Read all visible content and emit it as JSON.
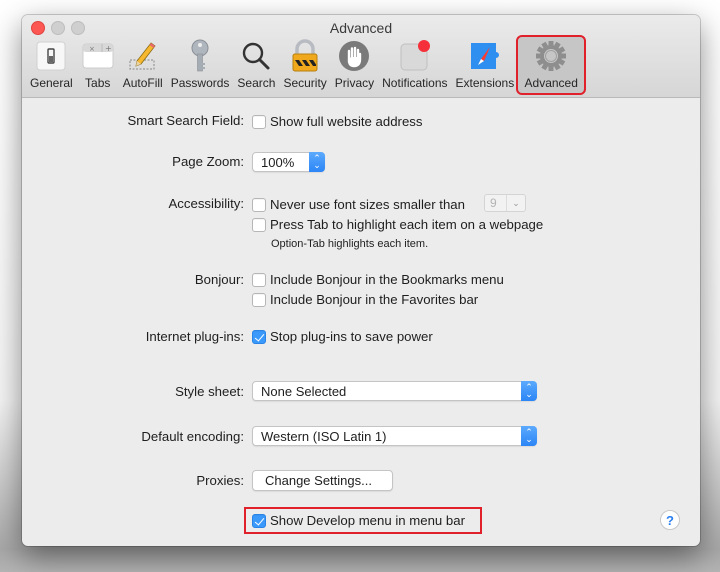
{
  "window": {
    "title": "Advanced",
    "controls": [
      "close",
      "minimize",
      "zoom"
    ]
  },
  "toolbar": {
    "items": [
      {
        "label": "General",
        "icon": "general-switch-icon"
      },
      {
        "label": "Tabs",
        "icon": "tabs-icon"
      },
      {
        "label": "AutoFill",
        "icon": "pencil-icon"
      },
      {
        "label": "Passwords",
        "icon": "key-icon"
      },
      {
        "label": "Search",
        "icon": "magnifier-icon"
      },
      {
        "label": "Security",
        "icon": "padlock-icon"
      },
      {
        "label": "Privacy",
        "icon": "hand-icon"
      },
      {
        "label": "Notifications",
        "icon": "notification-badge-icon"
      },
      {
        "label": "Extensions",
        "icon": "puzzle-compass-icon"
      },
      {
        "label": "Advanced",
        "icon": "gear-icon",
        "selected": true
      }
    ]
  },
  "settings": {
    "smart_search": {
      "label": "Smart Search Field:",
      "option": "Show full website address",
      "checked": false
    },
    "page_zoom": {
      "label": "Page Zoom:",
      "value": "100%"
    },
    "accessibility": {
      "label": "Accessibility:",
      "font_option": "Never use font sizes smaller than",
      "font_checked": false,
      "font_size_value": "9",
      "tab_option": "Press Tab to highlight each item on a webpage",
      "tab_checked": false,
      "note": "Option-Tab highlights each item."
    },
    "bonjour": {
      "label": "Bonjour:",
      "bookmarks_option": "Include Bonjour in the Bookmarks menu",
      "bookmarks_checked": false,
      "favorites_option": "Include Bonjour in the Favorites bar",
      "favorites_checked": false
    },
    "plugins": {
      "label": "Internet plug-ins:",
      "option": "Stop plug-ins to save power",
      "checked": true
    },
    "style_sheet": {
      "label": "Style sheet:",
      "value": "None Selected"
    },
    "encoding": {
      "label": "Default encoding:",
      "value": "Western (ISO Latin 1)"
    },
    "proxies": {
      "label": "Proxies:",
      "button": "Change Settings..."
    },
    "develop_menu": {
      "option": "Show Develop menu in menu bar",
      "checked": true
    }
  },
  "help": {
    "label": "?"
  },
  "colors": {
    "accent": "#3b99fc",
    "highlight_box": "#e0202a",
    "close_button": "#fc5753"
  }
}
